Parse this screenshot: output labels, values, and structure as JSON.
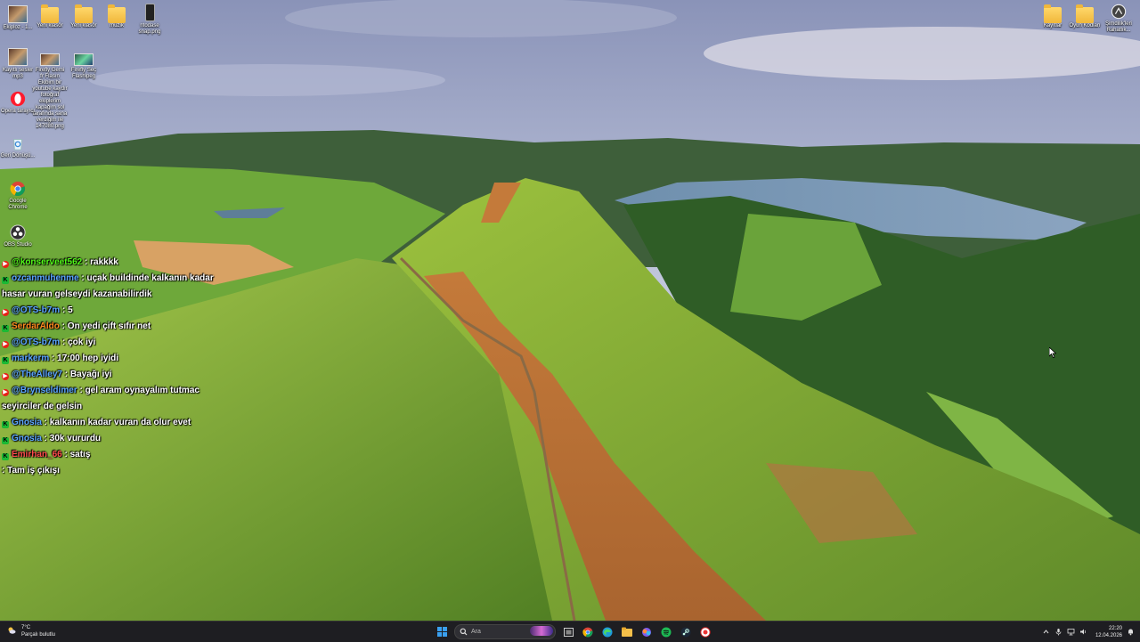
{
  "desktop_icons_left": [
    {
      "label": "Ekiploz - 1..."
    },
    {
      "label": "Yeni klasör"
    },
    {
      "label": "Yeni klasör"
    },
    {
      "label": "müzik"
    },
    {
      "label": "ntodase\nsnap.png"
    },
    {
      "label": "Kayıtlı sesler\nmp3"
    },
    {
      "label": "Firefly Gemi\nfr Flasın Ekibim bir youtube kaydır fotoğraf ekiplerim kapağım sol tarafında sana verdiğim ile 147080.png"
    },
    {
      "label": "Firefly Seç\nFlashlpeg"
    },
    {
      "label": "Opera tarayıcı"
    },
    {
      "label": "Geri Dönüşü..."
    },
    {
      "label": "Google Chrome"
    },
    {
      "label": "OBS Studio"
    }
  ],
  "desktop_icons_right": [
    {
      "label": "Kayıtlar"
    },
    {
      "label": "Oyun Kodları"
    },
    {
      "label": "Şimdilik'leri Rahatlık..."
    }
  ],
  "chat": [
    {
      "platform": "yt",
      "user": "@konserveet562",
      "msg": "rakkkk",
      "color": "green"
    },
    {
      "platform": "kick",
      "user": "ozcanmuhenme",
      "msg": "uçak buildinde kalkanın kadar hasar vuran gelseydi kazanabilirdik",
      "color": "blue"
    },
    {
      "platform": "yt",
      "user": "@OTS-b7m",
      "msg": "5",
      "color": "blue"
    },
    {
      "platform": "kick",
      "user": "SerdarAldo",
      "msg": "On yedi çift sıfır net",
      "color": "orange"
    },
    {
      "platform": "yt",
      "user": "@OTS-b7m",
      "msg": "çok iyi",
      "color": "blue"
    },
    {
      "platform": "kick",
      "user": "markerm",
      "msg": "17:00 hep iyidi",
      "color": "blue"
    },
    {
      "platform": "yt",
      "user": "@TheAlley7",
      "msg": "Bayağı iyi",
      "color": "blue"
    },
    {
      "platform": "yt",
      "user": "@Brynseldimer",
      "msg": "gel aram oynayalım tutmac seyirciler de gelsin",
      "color": "blue"
    },
    {
      "platform": "kick",
      "user": "Gnosia",
      "msg": "kalkanın kadar vuran da olur evet",
      "color": "blue"
    },
    {
      "platform": "kick",
      "user": "Gnosia",
      "msg": "30k vururdu",
      "color": "blue"
    },
    {
      "platform": "kick",
      "user": "Emirhan_66",
      "msg": "satış",
      "color": "red"
    },
    {
      "platform": "none",
      "user": "",
      "msg": "Tam iş çıkışı",
      "color": "pink"
    }
  ],
  "taskbar": {
    "weather_temp": "7°C",
    "weather_desc": "Parçalı bulutlu",
    "search_placeholder": "Ara",
    "time": "22:20",
    "date": "12.04.2026"
  },
  "colors": {
    "taskbar_bg": "#1e1e22",
    "sky": "#8fa3c4",
    "grass": "#7cb53a"
  }
}
